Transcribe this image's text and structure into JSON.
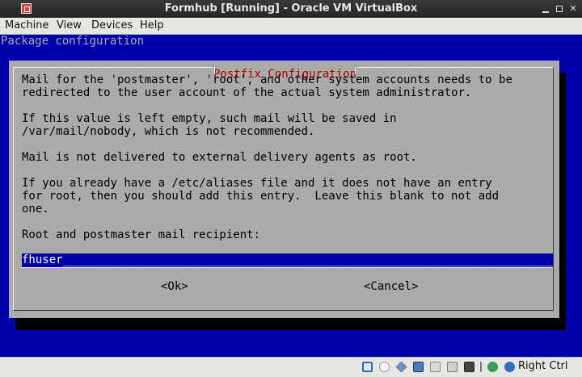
{
  "window": {
    "title": "Formhub [Running] - Oracle VM VirtualBox"
  },
  "menu": {
    "items": [
      "Machine",
      "View",
      "Devices",
      "Help"
    ]
  },
  "vm": {
    "header": "Package configuration",
    "dialog": {
      "title": "Postfix Configuration",
      "lines": [
        "Mail for the 'postmaster', 'root', and other system accounts needs to be",
        "redirected to the user account of the actual system administrator.",
        "If this value is left empty, such mail will be saved in",
        "/var/mail/nobody, which is not recommended.",
        "Mail is not delivered to external delivery agents as root.",
        "If you already have a /etc/aliases file and it does not have an entry",
        "for root, then you should add this entry.  Leave this blank to not add",
        "one.",
        "Root and postmaster mail recipient:"
      ],
      "input_value": "fhuser",
      "input_fill": "__________________________________________________________________________",
      "ok_label": "<Ok>",
      "cancel_label": "<Cancel>"
    }
  },
  "statusbar": {
    "host_key": "Right Ctrl",
    "icons": [
      "hard-disk-icon",
      "optical-drive-icon",
      "usb-icon",
      "network-icon",
      "shared-folders-icon",
      "display-icon",
      "video-capture-icon",
      "cpu-icon",
      "mouse-integration-icon",
      "arrow-icon"
    ]
  },
  "colors": {
    "vm_background": "#0000aa",
    "dialog_background": "#aaaaaa",
    "dialog_title": "#aa0000"
  }
}
